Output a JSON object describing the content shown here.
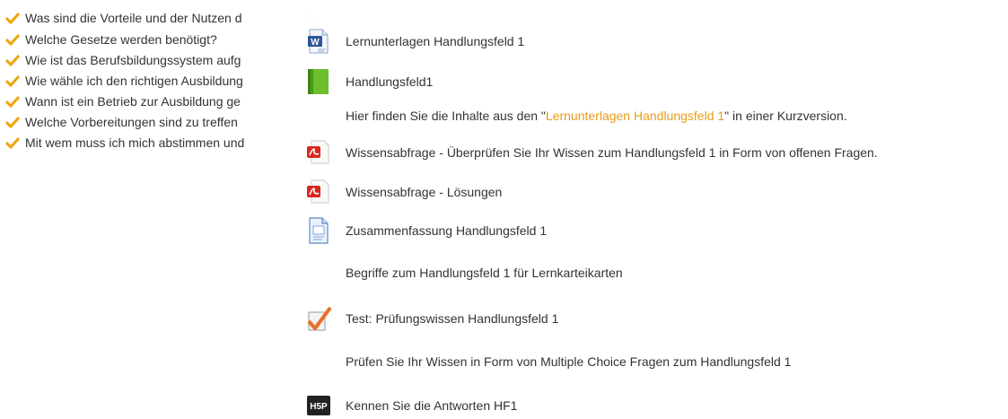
{
  "checklist": {
    "items": [
      "Was sind die Vorteile und der Nutzen d",
      "Welche Gesetze werden benötigt?",
      "Wie ist das Berufsbildungssystem aufg",
      "Wie wähle ich den richtigen Ausbildung",
      "Wann ist ein Betrieb zur Ausbildung ge",
      "Welche Vorbereitungen sind zu treffen",
      "Mit wem muss ich mich abstimmen und"
    ],
    "check_color": "#f0a30a"
  },
  "activities": {
    "faded_fragment": "...",
    "items": [
      {
        "icon": "word-document-icon",
        "label": "Lernunterlagen Handlungsfeld 1"
      },
      {
        "icon": "book-icon",
        "label": "Handlungsfeld1"
      },
      {
        "icon": "pdf-icon",
        "label": "Wissensabfrage - Überprüfen Sie Ihr Wissen zum Handlungsfeld 1 in Form von offenen Fragen."
      },
      {
        "icon": "pdf-icon",
        "label": "Wissensabfrage - Lösungen"
      },
      {
        "icon": "page-icon",
        "label": "Zusammenfassung Handlungsfeld 1"
      },
      {
        "icon": "quiz-icon",
        "label": "Test: Prüfungswissen Handlungsfeld 1"
      },
      {
        "icon": "h5p-icon",
        "label": "Kennen Sie die Antworten HF1"
      }
    ],
    "book_description": {
      "before": "Hier finden Sie die Inhalte aus den \"",
      "highlight": "Lernunterlagen Handlungsfeld 1",
      "after": "\" in einer Kurzversion."
    },
    "summary_description": "Begriffe zum Handlungsfeld 1 für Lernkarteikarten",
    "quiz_description": "Prüfen Sie Ihr Wissen in Form von Multiple Choice Fragen zum Handlungsfeld 1",
    "highlight_color": "#e89c1a"
  }
}
